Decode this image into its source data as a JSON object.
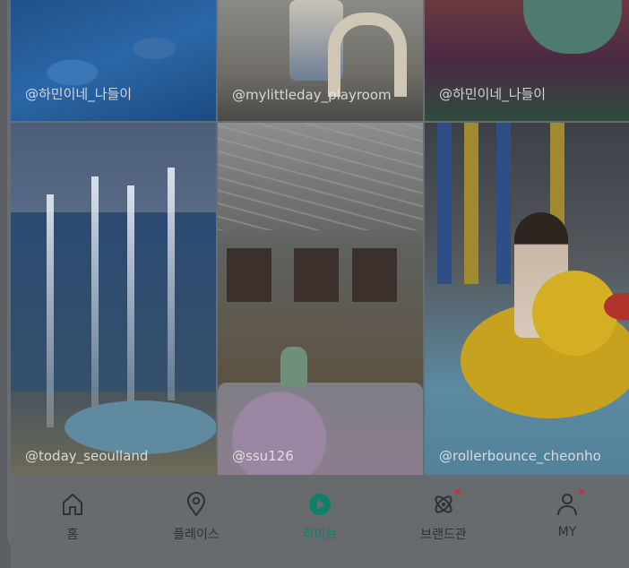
{
  "feed": {
    "tiles": [
      {
        "handle": "@하민이네_나들이"
      },
      {
        "handle": "@mylittleday_playroom"
      },
      {
        "handle": "@하민이네_나들이"
      },
      {
        "handle": "@today_seoulland"
      },
      {
        "handle": "@ssu126"
      },
      {
        "handle": "@rollerbounce_cheonho"
      }
    ]
  },
  "nav": {
    "items": [
      {
        "label": "홈",
        "icon": "home-icon",
        "active": false,
        "badge": false
      },
      {
        "label": "플레이스",
        "icon": "location-pin-icon",
        "active": false,
        "badge": false
      },
      {
        "label": "라이브",
        "icon": "play-icon",
        "active": true,
        "badge": false
      },
      {
        "label": "브랜드관",
        "icon": "atom-icon",
        "active": false,
        "badge": true
      },
      {
        "label": "MY",
        "icon": "person-icon",
        "active": false,
        "badge": true
      }
    ],
    "colors": {
      "active": "#0f7f6a",
      "badge": "#c0343a",
      "inactive": "#2f3133"
    }
  }
}
